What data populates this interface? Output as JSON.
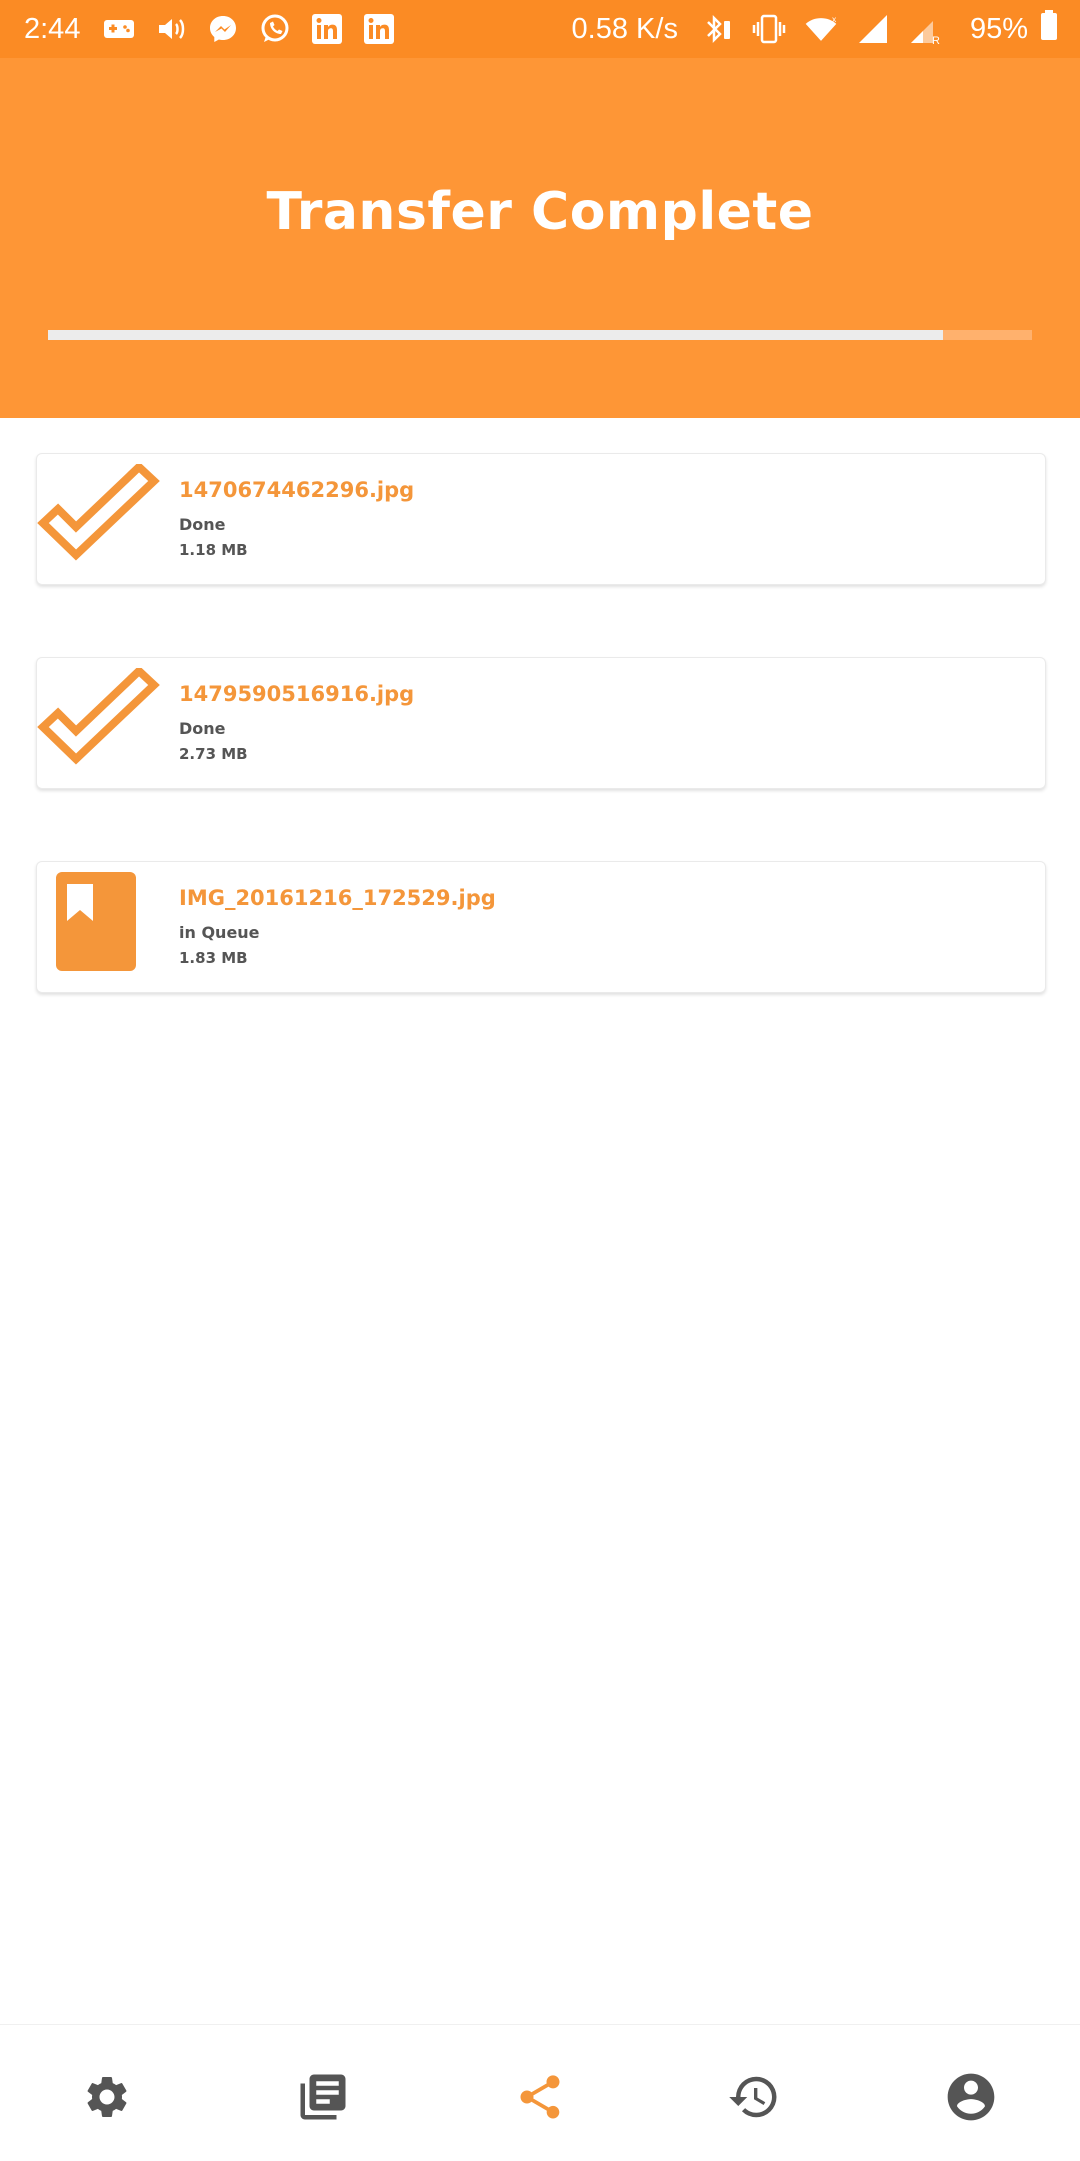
{
  "status_bar": {
    "time": "2:44",
    "speed": "0.58 K/s",
    "battery": "95%",
    "icons_left": [
      "game-icon",
      "volume-icon",
      "messenger-icon",
      "whatsapp-icon",
      "linkedin-icon",
      "linkedin-icon"
    ],
    "icons_right": [
      "bluetooth-icon",
      "vibrate-icon",
      "wifi-icon",
      "signal-icon",
      "signal-roaming-icon",
      "battery-icon"
    ]
  },
  "header": {
    "title": "Transfer Complete",
    "progress": 0.91
  },
  "transfers": [
    {
      "name": "1470674462296.jpg",
      "status": "Done",
      "size": "1.18 MB",
      "icon": "checkmark-icon"
    },
    {
      "name": "1479590516916.jpg",
      "status": "Done",
      "size": "2.73 MB",
      "icon": "checkmark-icon"
    },
    {
      "name": "IMG_20161216_172529.jpg",
      "status": "in Queue",
      "size": "1.83 MB",
      "icon": "bookmark-file-icon"
    }
  ],
  "bottom_nav": {
    "items": [
      {
        "icon": "settings-icon",
        "active": false
      },
      {
        "icon": "library-icon",
        "active": false
      },
      {
        "icon": "share-icon",
        "active": true
      },
      {
        "icon": "history-icon",
        "active": false
      },
      {
        "icon": "account-icon",
        "active": false
      }
    ]
  },
  "colors": {
    "status_bar": "#fb8b24",
    "header": "#fe9636",
    "accent": "#f4963a",
    "nav_inactive": "#555555"
  }
}
